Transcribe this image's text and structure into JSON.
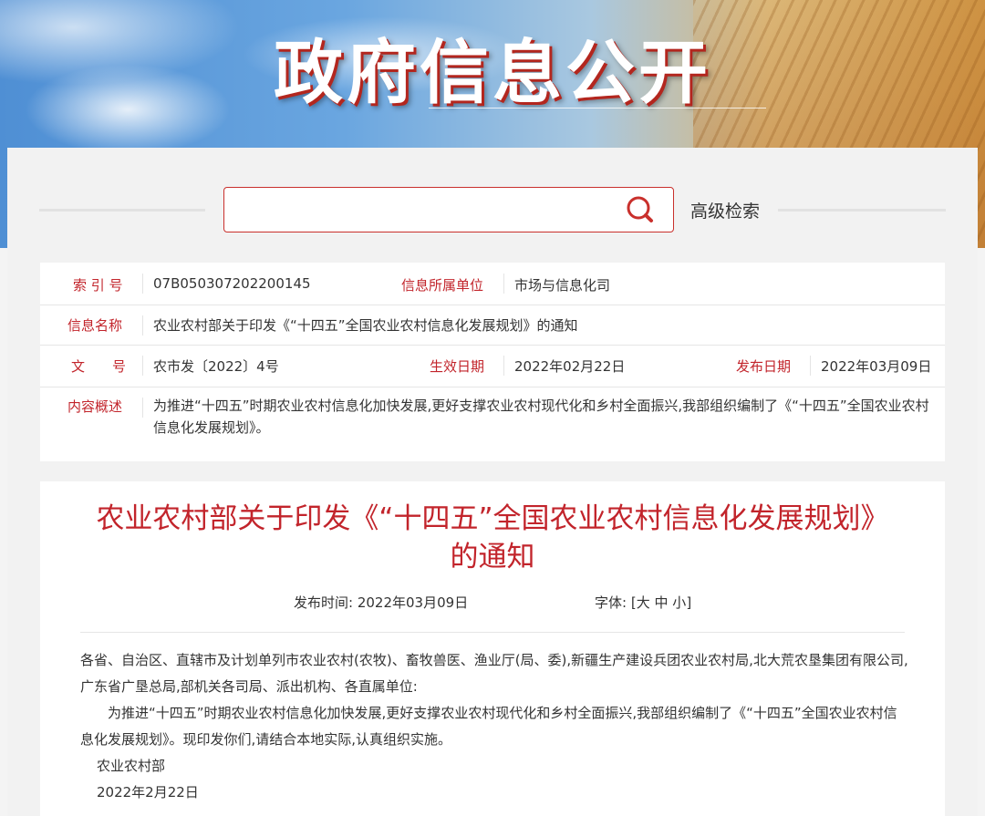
{
  "banner": {
    "title": "政府信息公开"
  },
  "search": {
    "placeholder": "",
    "advanced_label": "高级检索"
  },
  "info": {
    "index_label": "索 引 号",
    "index_value": "07B050307202200145",
    "unit_label": "信息所属单位",
    "unit_value": "市场与信息化司",
    "name_label": "信息名称",
    "name_value": "农业农村部关于印发《“十四五”全国农业农村信息化发展规划》的通知",
    "doc_label": "文　　号",
    "doc_value": "农市发〔2022〕4号",
    "effective_label": "生效日期",
    "effective_value": "2022年02月22日",
    "publish_label": "发布日期",
    "publish_value": "2022年03月09日",
    "summary_label": "内容概述",
    "summary_value": "为推进“十四五”时期农业农村信息化加快发展,更好支撑农业农村现代化和乡村全面振兴,我部组织编制了《“十四五”全国农业农村信息化发展规划》。"
  },
  "article": {
    "title_line1": "农业农村部关于印发《“十四五”全国农业农村信息化发展规划》",
    "title_line2": "的通知",
    "publish_time_label": "发布时间:",
    "publish_time_value": "2022年03月09日",
    "font_label": "字体:",
    "font_open": "[",
    "font_large": "大",
    "font_medium": "中",
    "font_small": "小",
    "font_close": "]",
    "recipients": "各省、自治区、直辖市及计划单列市农业农村(农牧)、畜牧兽医、渔业厅(局、委),新疆生产建设兵团农业农村局,北大荒农垦集团有限公司,广东省广垦总局,部机关各司局、派出机构、各直属单位:",
    "body": "为推进“十四五”时期农业农村信息化加快发展,更好支撑农业农村现代化和乡村全面振兴,我部组织编制了《“十四五”全国农业农村信息化发展规划》。现印发你们,请结合本地实际,认真组织实施。",
    "signature": "农业农村部",
    "date": "2022年2月22日"
  },
  "colors": {
    "accent": "#c2242b",
    "panel": "#f2f2f2"
  }
}
